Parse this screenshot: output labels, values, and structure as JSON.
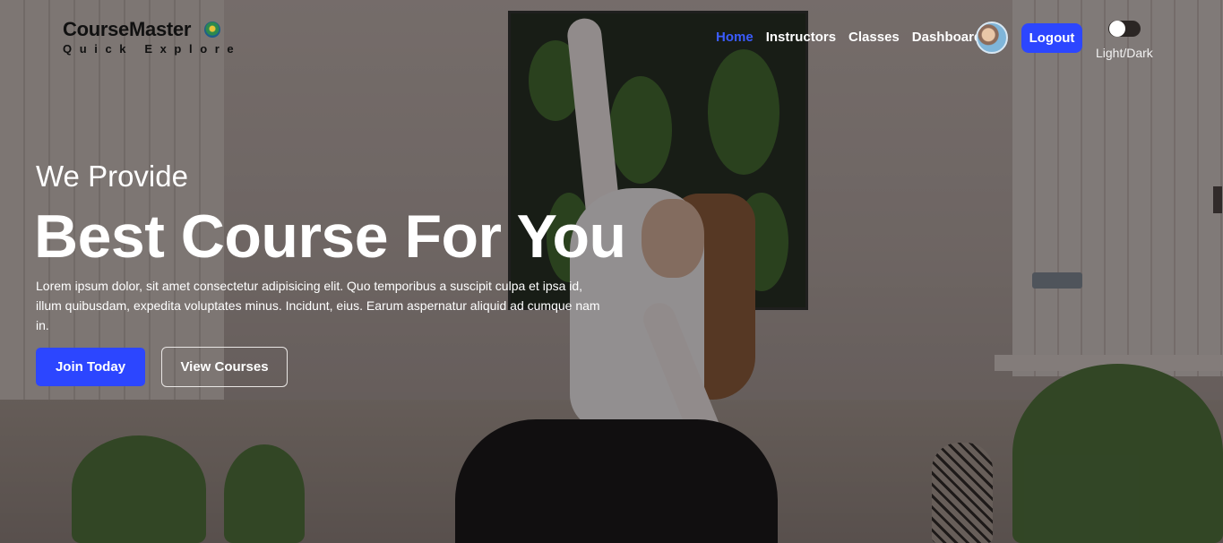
{
  "brand": {
    "name": "CourseMaster",
    "tagline": "Quick Explore"
  },
  "nav": {
    "items": [
      {
        "label": "Home",
        "active": true
      },
      {
        "label": "Instructors",
        "active": false
      },
      {
        "label": "Classes",
        "active": false
      },
      {
        "label": "Dashboard",
        "active": false
      }
    ],
    "logout_label": "Logout",
    "theme_toggle_label": "Light/Dark",
    "avatar_icon": "user-avatar"
  },
  "hero": {
    "subtitle": "We Provide",
    "title": "Best Course For You",
    "description": "Lorem ipsum dolor, sit amet consectetur adipisicing elit. Quo temporibus a suscipit culpa et ipsa id, illum quibusdam, expedita voluptates minus. Incidunt, eius. Earum aspernatur aliquid ad cumque nam in.",
    "primary_button": "Join Today",
    "secondary_button": "View Courses"
  },
  "colors": {
    "accent": "#2c46ff",
    "nav_active": "#3b5cff",
    "text_light": "#ffffff"
  }
}
